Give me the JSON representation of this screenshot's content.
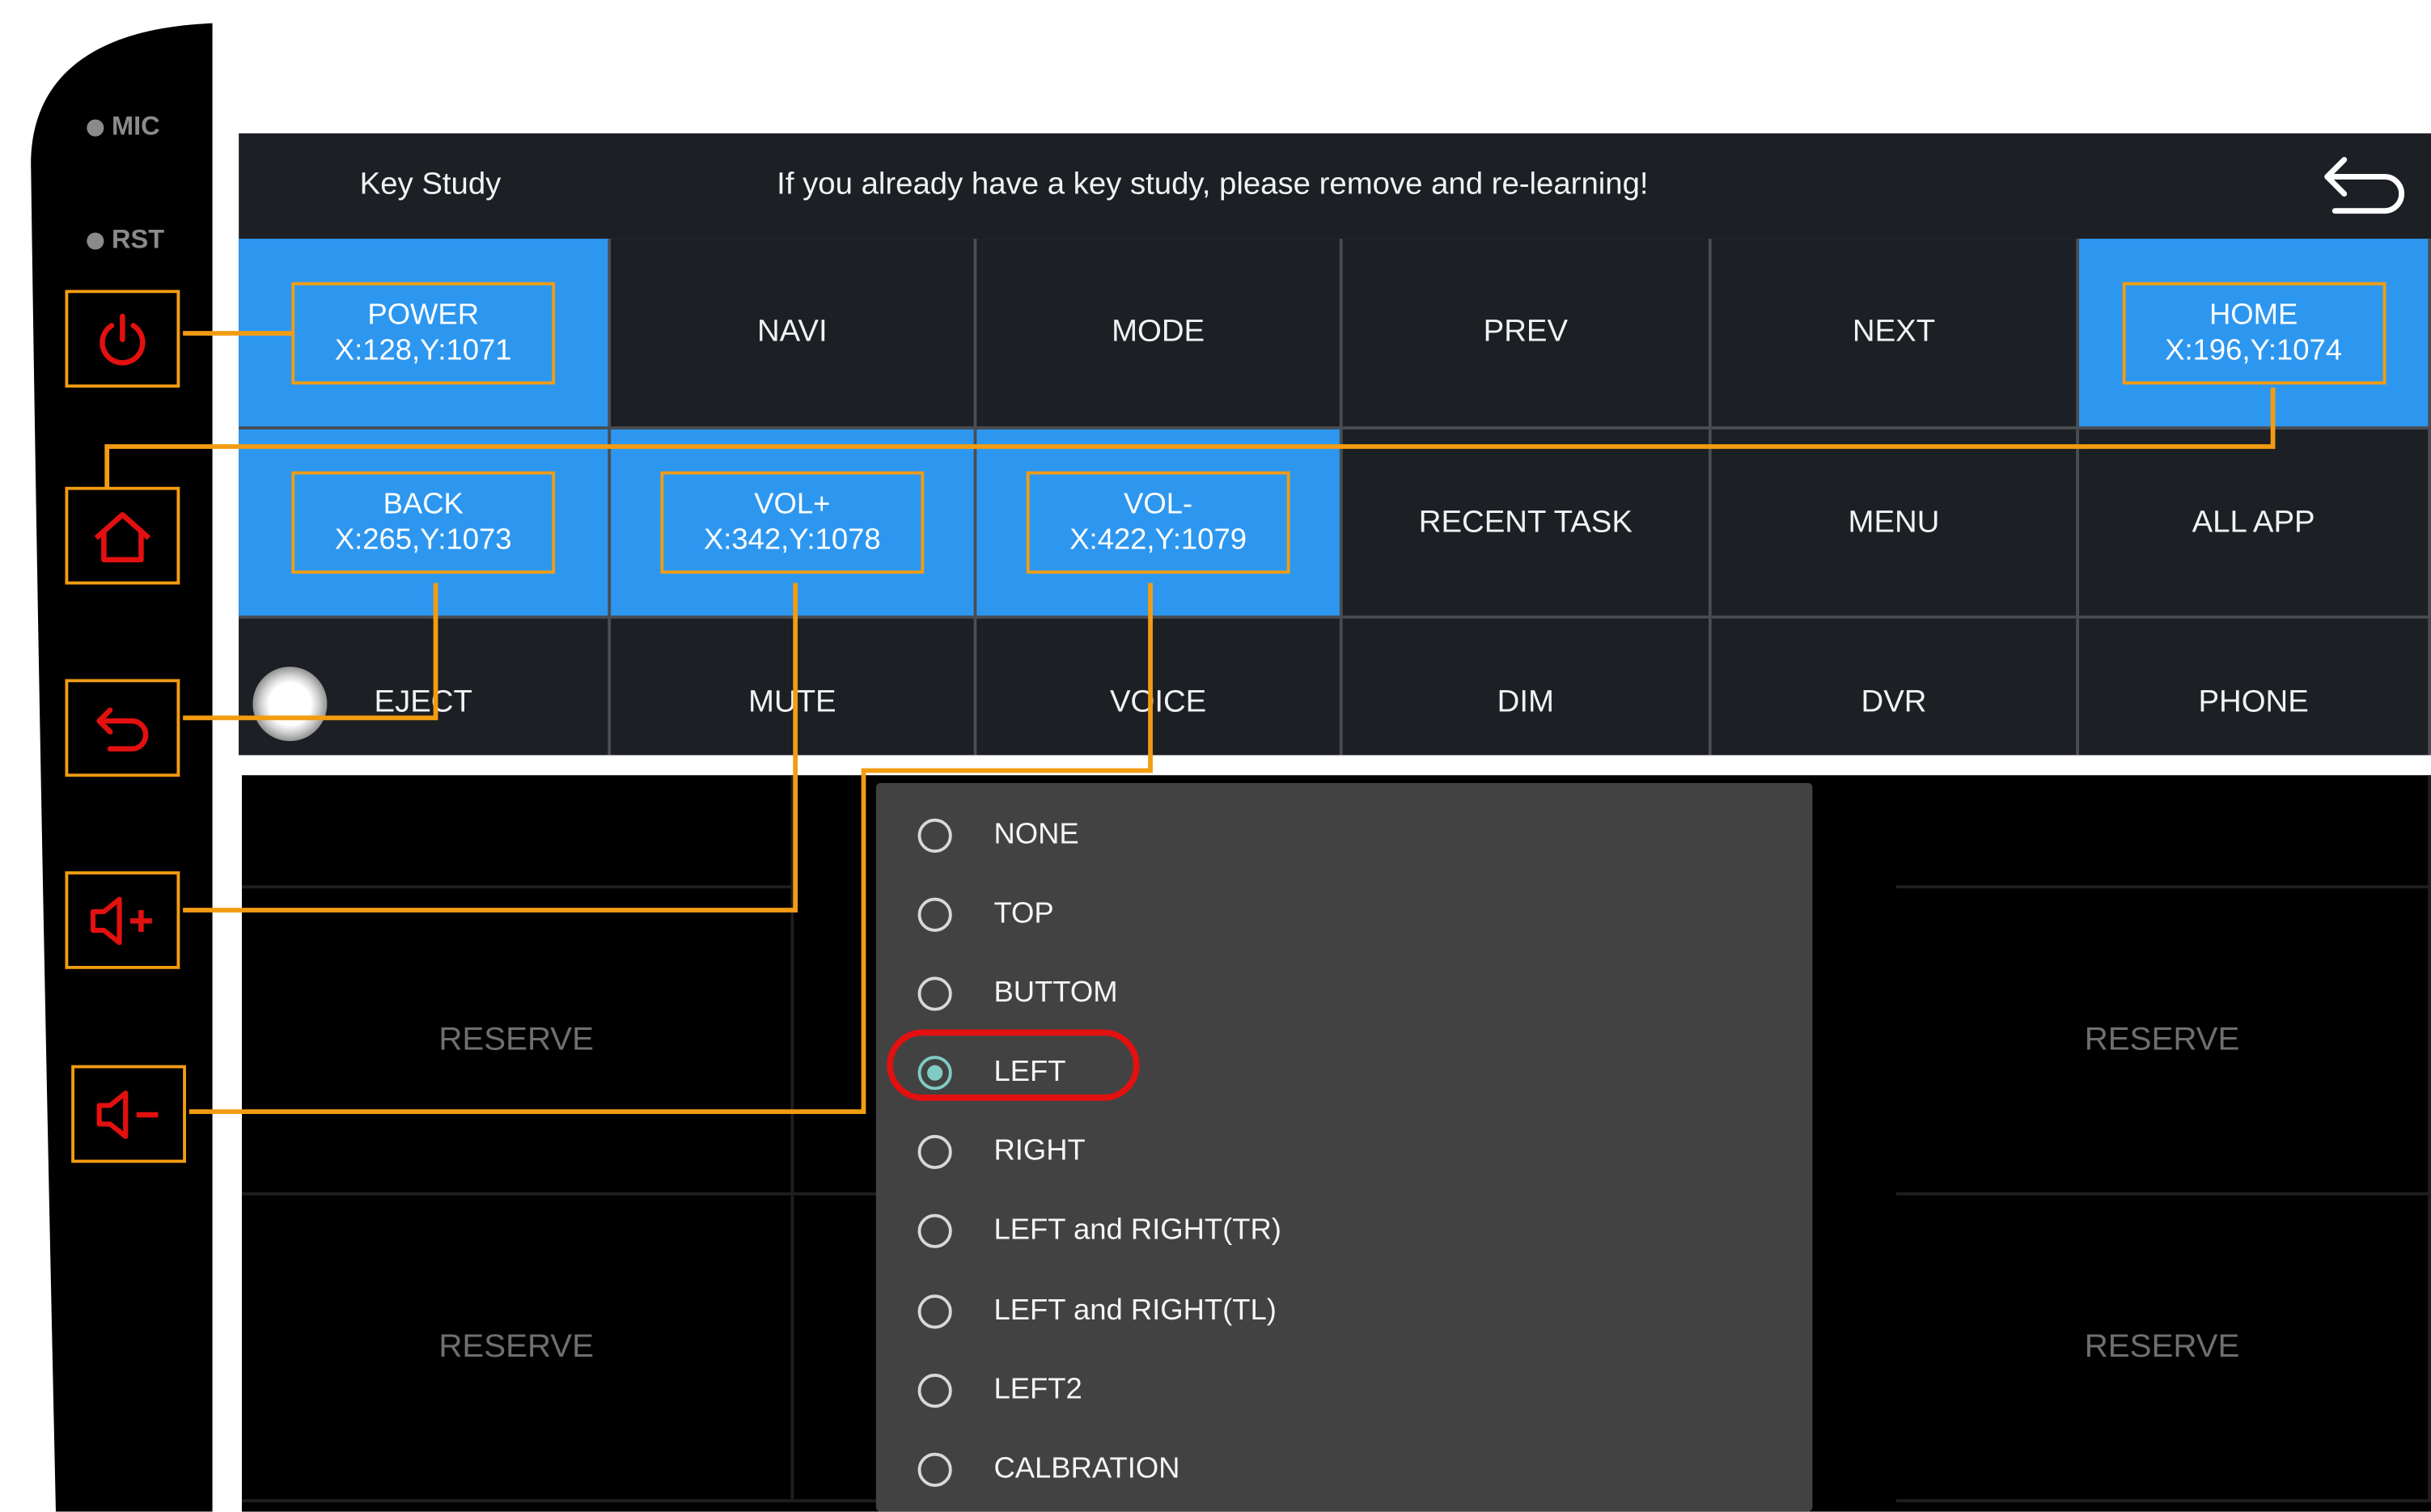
{
  "bezel": {
    "mic_label": "MIC",
    "rst_label": "RST",
    "buttons": [
      {
        "name": "power",
        "icon": "power-icon"
      },
      {
        "name": "home",
        "icon": "home-icon"
      },
      {
        "name": "back",
        "icon": "back-icon"
      },
      {
        "name": "volume-up",
        "icon": "volume-up-icon"
      },
      {
        "name": "volume-down",
        "icon": "volume-down-icon"
      }
    ],
    "accent_color": "#f39c12",
    "icon_color": "#e31010"
  },
  "header": {
    "title": "Key Study",
    "message": "If you already have a key study, please remove and re-learning!",
    "back_icon": "return-arrow-icon"
  },
  "keys": {
    "power": {
      "label": "POWER",
      "coord": "X:128,Y:1071"
    },
    "navi": "NAVI",
    "mode": "MODE",
    "prev": "PREV",
    "next": "NEXT",
    "home": {
      "label": "HOME",
      "coord": "X:196,Y:1074"
    },
    "back": {
      "label": "BACK",
      "coord": "X:265,Y:1073"
    },
    "vol_up": {
      "label": "VOL+",
      "coord": "X:342,Y:1078"
    },
    "vol_down": {
      "label": "VOL-",
      "coord": "X:422,Y:1079"
    },
    "recent_task": "RECENT TASK",
    "menu": "MENU",
    "all_app": "ALL APP",
    "eject": "EJECT",
    "mute": "MUTE",
    "voice": "VOICE",
    "dim": "DIM",
    "dvr": "DVR",
    "phone": "PHONE"
  },
  "reserve": {
    "label": "RESERVE"
  },
  "position_dialog": {
    "options": [
      "NONE",
      "TOP",
      "BUTTOM",
      "LEFT",
      "RIGHT",
      "LEFT and RIGHT(TR)",
      "LEFT and RIGHT(TL)",
      "LEFT2",
      "CALBRATION"
    ],
    "selected": "LEFT",
    "selected_color": "#80cbc4",
    "highlight_color": "#e31010"
  },
  "colors": {
    "learned_key": "#2d97f0",
    "key_bg": "#1c1f24"
  }
}
